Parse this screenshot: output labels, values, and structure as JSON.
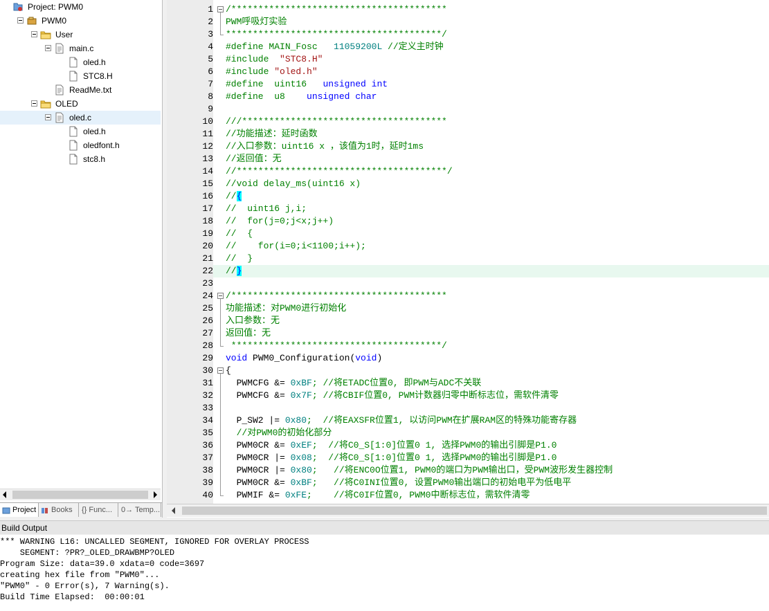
{
  "project_tree": [
    {
      "label": "Project: PWM0",
      "kind": "project",
      "expanded": true
    },
    {
      "label": "PWM0",
      "kind": "target",
      "expanded": true
    },
    {
      "label": "User",
      "kind": "folder",
      "expanded": true
    },
    {
      "label": "main.c",
      "kind": "file",
      "expanded": true
    },
    {
      "label": "oled.h",
      "kind": "header"
    },
    {
      "label": "STC8.H",
      "kind": "header"
    },
    {
      "label": "ReadMe.txt",
      "kind": "file"
    },
    {
      "label": "OLED",
      "kind": "folder",
      "expanded": true
    },
    {
      "label": "oled.c",
      "kind": "file",
      "expanded": true,
      "selected": true
    },
    {
      "label": "oled.h",
      "kind": "header"
    },
    {
      "label": "oledfont.h",
      "kind": "header"
    },
    {
      "label": "stc8.h",
      "kind": "header"
    }
  ],
  "panel_tabs": [
    {
      "label": "Project",
      "icon": "project-icon",
      "active": true
    },
    {
      "label": "Books",
      "icon": "books-icon"
    },
    {
      "label": "{} Func...",
      "icon": "functions-icon"
    },
    {
      "label": "0→ Temp...",
      "icon": "templates-icon"
    }
  ],
  "editor": {
    "current_line": 22,
    "lines": [
      {
        "n": "1",
        "segs": [
          {
            "t": "/****************************************",
            "c": "c"
          }
        ]
      },
      {
        "n": "2",
        "segs": [
          {
            "t": "PWM呼吸灯实验",
            "c": "c"
          }
        ]
      },
      {
        "n": "3",
        "segs": [
          {
            "t": "****************************************/",
            "c": "c"
          }
        ]
      },
      {
        "n": "4",
        "segs": [
          {
            "t": "#define MAIN_Fosc   ",
            "c": "c"
          },
          {
            "t": "11059200L",
            "c": "n"
          },
          {
            "t": " //定义主时钟",
            "c": "c"
          }
        ]
      },
      {
        "n": "5",
        "segs": [
          {
            "t": "#include  ",
            "c": "c"
          },
          {
            "t": "\"STC8.H\"",
            "c": "s"
          }
        ]
      },
      {
        "n": "6",
        "segs": [
          {
            "t": "#include ",
            "c": "c"
          },
          {
            "t": "\"oled.h\"",
            "c": "s"
          }
        ]
      },
      {
        "n": "7",
        "segs": [
          {
            "t": "#define  uint16   ",
            "c": "c"
          },
          {
            "t": "unsigned int",
            "c": "k"
          }
        ]
      },
      {
        "n": "8",
        "segs": [
          {
            "t": "#define  u8    ",
            "c": "c"
          },
          {
            "t": "unsigned char",
            "c": "k"
          }
        ]
      },
      {
        "n": "9",
        "segs": []
      },
      {
        "n": "10",
        "segs": [
          {
            "t": "///**************************************",
            "c": "c"
          }
        ]
      },
      {
        "n": "11",
        "segs": [
          {
            "t": "//功能描述：延时函数",
            "c": "c"
          }
        ]
      },
      {
        "n": "12",
        "segs": [
          {
            "t": "//入口参数：uint16 x ，该值为1时，延时1ms",
            "c": "c"
          }
        ]
      },
      {
        "n": "13",
        "segs": [
          {
            "t": "//返回值：无",
            "c": "c"
          }
        ]
      },
      {
        "n": "14",
        "segs": [
          {
            "t": "//***************************************/",
            "c": "c"
          }
        ]
      },
      {
        "n": "15",
        "segs": [
          {
            "t": "//void delay_ms(uint16 x)",
            "c": "c"
          }
        ]
      },
      {
        "n": "16",
        "segs": [
          {
            "t": "//",
            "c": "c"
          },
          {
            "t": "{",
            "c": "b"
          }
        ]
      },
      {
        "n": "17",
        "segs": [
          {
            "t": "//  uint16 j,i;",
            "c": "c"
          }
        ]
      },
      {
        "n": "18",
        "segs": [
          {
            "t": "//  for(j=0;j<x;j++)",
            "c": "c"
          }
        ]
      },
      {
        "n": "19",
        "segs": [
          {
            "t": "//  {",
            "c": "c"
          }
        ]
      },
      {
        "n": "20",
        "segs": [
          {
            "t": "//    for(i=0;i<1100;i++);",
            "c": "c"
          }
        ]
      },
      {
        "n": "21",
        "segs": [
          {
            "t": "//  }",
            "c": "c"
          }
        ]
      },
      {
        "n": "22",
        "segs": [
          {
            "t": "//",
            "c": "c"
          },
          {
            "t": "}",
            "c": "b"
          }
        ]
      },
      {
        "n": "23",
        "segs": []
      },
      {
        "n": "24",
        "segs": [
          {
            "t": "/****************************************",
            "c": "c"
          }
        ]
      },
      {
        "n": "25",
        "segs": [
          {
            "t": "功能描述：对PWM0进行初始化",
            "c": "c"
          }
        ]
      },
      {
        "n": "26",
        "segs": [
          {
            "t": "入口参数：无",
            "c": "c"
          }
        ]
      },
      {
        "n": "27",
        "segs": [
          {
            "t": "返回值：无",
            "c": "c"
          }
        ]
      },
      {
        "n": "28",
        "segs": [
          {
            "t": " ***************************************/",
            "c": "c"
          }
        ]
      },
      {
        "n": "29",
        "segs": [
          {
            "t": "void",
            "c": "k"
          },
          {
            "t": " PWM0_Configuration(",
            "c": ""
          },
          {
            "t": "void",
            "c": "k"
          },
          {
            "t": ")",
            "c": ""
          }
        ]
      },
      {
        "n": "30",
        "segs": [
          {
            "t": "{",
            "c": ""
          }
        ]
      },
      {
        "n": "31",
        "segs": [
          {
            "t": "  PWMCFG &= ",
            "c": ""
          },
          {
            "t": "0xBF",
            "c": "n"
          },
          {
            "t": "; //将ETADC位置0, 即PWM与ADC不关联",
            "c": "c"
          }
        ]
      },
      {
        "n": "32",
        "segs": [
          {
            "t": "  PWMCFG &= ",
            "c": ""
          },
          {
            "t": "0x7F",
            "c": "n"
          },
          {
            "t": "; //将CBIF位置0, PWM计数器归零中断标志位，需软件清零",
            "c": "c"
          }
        ]
      },
      {
        "n": "33",
        "segs": []
      },
      {
        "n": "34",
        "segs": [
          {
            "t": "  P_SW2 |= ",
            "c": ""
          },
          {
            "t": "0x80",
            "c": "n"
          },
          {
            "t": ";  //将EAXSFR位置1, 以访问PWM在扩展RAM区的特殊功能寄存器",
            "c": "c"
          }
        ]
      },
      {
        "n": "35",
        "segs": [
          {
            "t": "  //对PWM0的初始化部分",
            "c": "c"
          }
        ]
      },
      {
        "n": "36",
        "segs": [
          {
            "t": "  PWM0CR &= ",
            "c": ""
          },
          {
            "t": "0xEF",
            "c": "n"
          },
          {
            "t": ";  //将C0_S[1:0]位置0 1, 选择PWM0的输出引脚是P1.0",
            "c": "c"
          }
        ]
      },
      {
        "n": "37",
        "segs": [
          {
            "t": "  PWM0CR |= ",
            "c": ""
          },
          {
            "t": "0x08",
            "c": "n"
          },
          {
            "t": ";  //将C0_S[1:0]位置0 1, 选择PWM0的输出引脚是P1.0",
            "c": "c"
          }
        ]
      },
      {
        "n": "38",
        "segs": [
          {
            "t": "  PWM0CR |= ",
            "c": ""
          },
          {
            "t": "0x80",
            "c": "n"
          },
          {
            "t": ";   //将ENC0O位置1, PWM0的端口为PWM输出口，受PWM波形发生器控制",
            "c": "c"
          }
        ]
      },
      {
        "n": "39",
        "segs": [
          {
            "t": "  PWM0CR &= ",
            "c": ""
          },
          {
            "t": "0xBF",
            "c": "n"
          },
          {
            "t": ";   //将C0INI位置0, 设置PWM0输出端口的初始电平为低电平",
            "c": "c"
          }
        ]
      },
      {
        "n": "40",
        "segs": [
          {
            "t": "  PWMIF &= ",
            "c": ""
          },
          {
            "t": "0xFE",
            "c": "n"
          },
          {
            "t": ";    //将C0IF位置0, PWM0中断标志位，需软件清零",
            "c": "c"
          }
        ]
      }
    ]
  },
  "build_output": {
    "title": "Build Output",
    "lines": [
      "*** WARNING L16: UNCALLED SEGMENT, IGNORED FOR OVERLAY PROCESS",
      "    SEGMENT: ?PR?_OLED_DRAWBMP?OLED",
      "Program Size: data=39.0 xdata=0 code=3697",
      "creating hex file from \"PWM0\"...",
      "\"PWM0\" - 0 Error(s), 7 Warning(s).",
      "Build Time Elapsed:  00:00:01"
    ]
  }
}
